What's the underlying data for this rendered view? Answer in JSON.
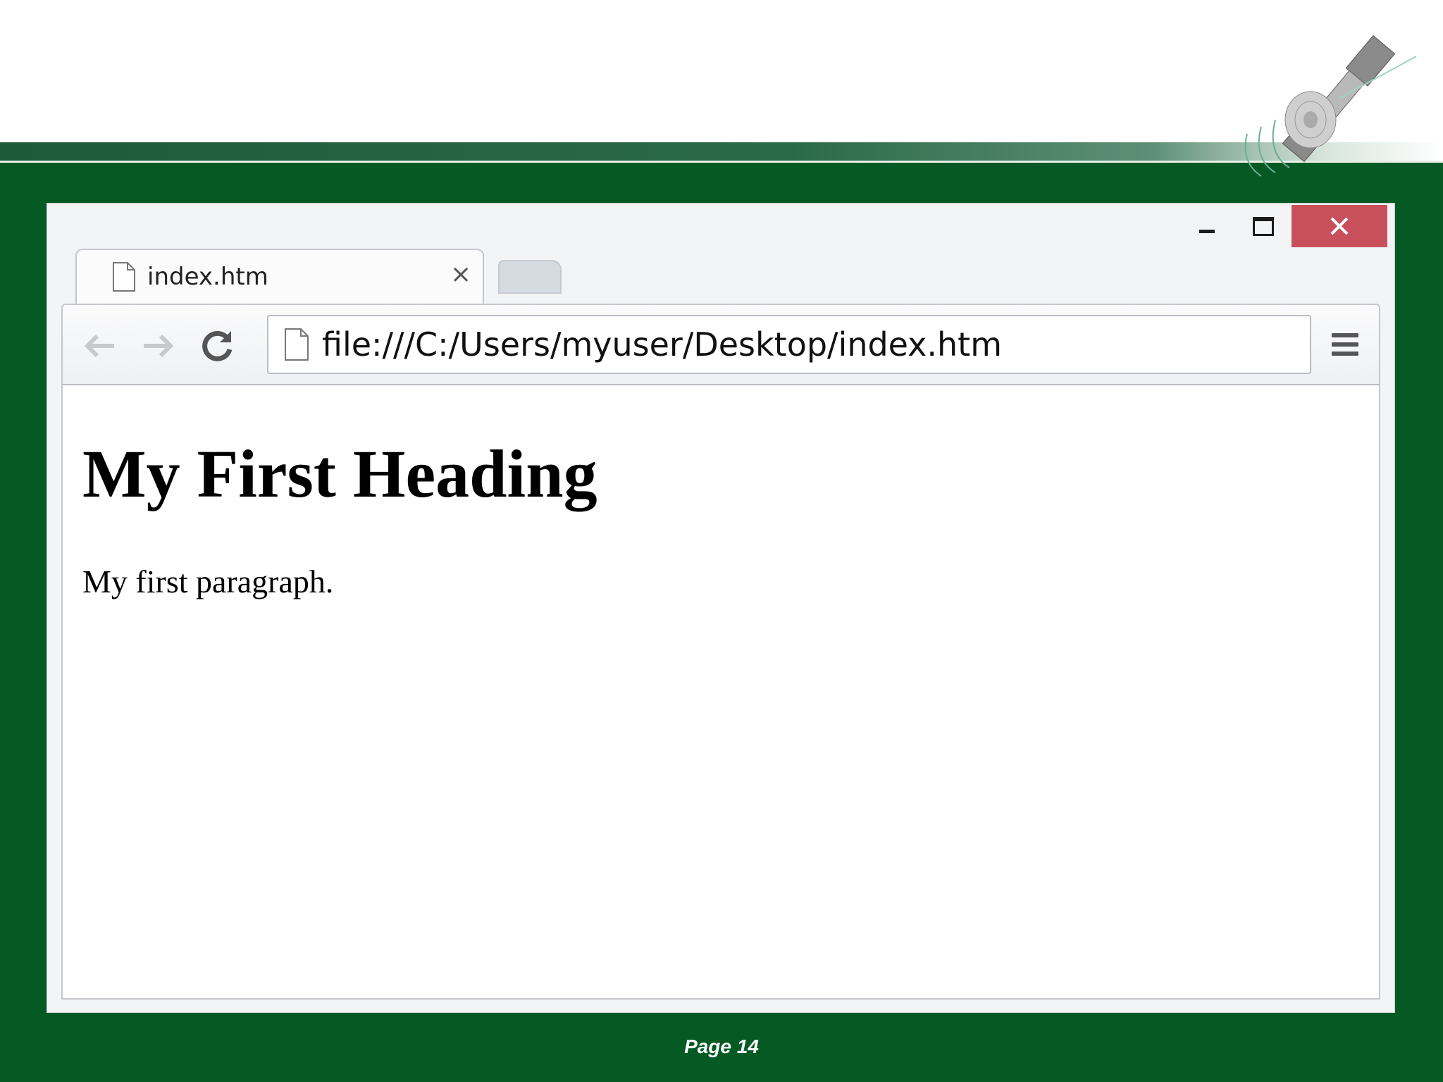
{
  "browser": {
    "tab": {
      "title": "index.htm",
      "close": "×"
    },
    "address_bar": {
      "value": "file:///C:/Users/myuser/Desktop/index.htm"
    },
    "window_controls": {
      "close": "✕"
    }
  },
  "page": {
    "heading": "My First Heading",
    "paragraph": "My first paragraph."
  },
  "slide": {
    "footer": "Page  14"
  },
  "colors": {
    "slide_background": "#055a24",
    "close_button": "#c7505a"
  },
  "icons": [
    "satellite-icon",
    "document-icon",
    "back-arrow-icon",
    "forward-arrow-icon",
    "reload-icon",
    "menu-icon",
    "minimize-icon",
    "maximize-icon",
    "close-icon"
  ]
}
